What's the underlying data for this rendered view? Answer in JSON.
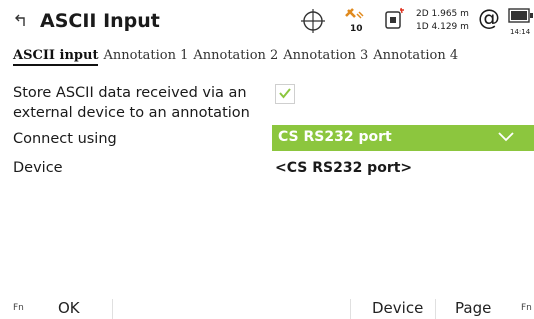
{
  "header": {
    "title": "ASCII Input",
    "satellite_count": "10",
    "precision_2d": "2D 1.965 m",
    "precision_1d": "1D 4.129 m",
    "at_symbol": "@",
    "time": "14:14"
  },
  "tabs": [
    {
      "label": "ASCII input",
      "active": true
    },
    {
      "label": "Annotation 1"
    },
    {
      "label": "Annotation 2"
    },
    {
      "label": "Annotation 3"
    },
    {
      "label": "Annotation 4"
    }
  ],
  "form": {
    "store_label": "Store ASCII data received via an external device to an annotation",
    "store_checked": true,
    "connect_label": "Connect using",
    "connect_value": "CS RS232 port",
    "device_label": "Device",
    "device_value": "<CS RS232 port>"
  },
  "bottom": {
    "fn_left": "Fn",
    "ok": "OK",
    "device": "Device",
    "page": "Page",
    "fn_right": "Fn"
  },
  "colors": {
    "accent": "#8cc63e"
  }
}
